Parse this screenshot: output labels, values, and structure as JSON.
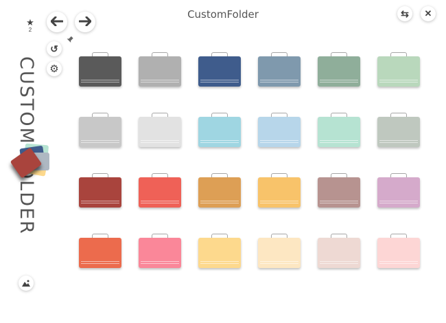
{
  "window": {
    "title": "CustomFolder",
    "favorites_count": "2",
    "vertical_title": "CUSTOM FOLDER"
  },
  "icons": {
    "star": "★",
    "back": "🡐",
    "forward": "🡒",
    "undo": "↺",
    "settings": "⚙",
    "pin": "📌",
    "swap": "⇆",
    "close": "✕",
    "image": "▲"
  },
  "folders": [
    {
      "name": "dark-gray",
      "color": "#5a5a5a"
    },
    {
      "name": "gray",
      "color": "#b0b0b0"
    },
    {
      "name": "navy",
      "color": "#3f5c8c"
    },
    {
      "name": "slate-blue",
      "color": "#7f99ad"
    },
    {
      "name": "sage",
      "color": "#8fae9a"
    },
    {
      "name": "mint-sage",
      "color": "#b9d8bc"
    },
    {
      "name": "light-gray",
      "color": "#c8c8c8"
    },
    {
      "name": "pale-gray",
      "color": "#e2e2e2"
    },
    {
      "name": "sky",
      "color": "#9fd6e2"
    },
    {
      "name": "light-blue",
      "color": "#b7d6ea"
    },
    {
      "name": "mint",
      "color": "#b6e3d2"
    },
    {
      "name": "gray-green",
      "color": "#bfc8bf"
    },
    {
      "name": "brick",
      "color": "#a9443d"
    },
    {
      "name": "coral-red",
      "color": "#ef6157"
    },
    {
      "name": "amber",
      "color": "#dd9f55"
    },
    {
      "name": "yellow-orange",
      "color": "#f8c36a"
    },
    {
      "name": "mauve",
      "color": "#b79390"
    },
    {
      "name": "lavender",
      "color": "#d5aacb"
    },
    {
      "name": "orange-red",
      "color": "#ec6b4d"
    },
    {
      "name": "pink",
      "color": "#fa8799"
    },
    {
      "name": "pale-yellow",
      "color": "#fdd98d"
    },
    {
      "name": "cream",
      "color": "#fde7c2"
    },
    {
      "name": "blush",
      "color": "#eed9d3"
    },
    {
      "name": "light-pink",
      "color": "#fdd6d5"
    }
  ]
}
